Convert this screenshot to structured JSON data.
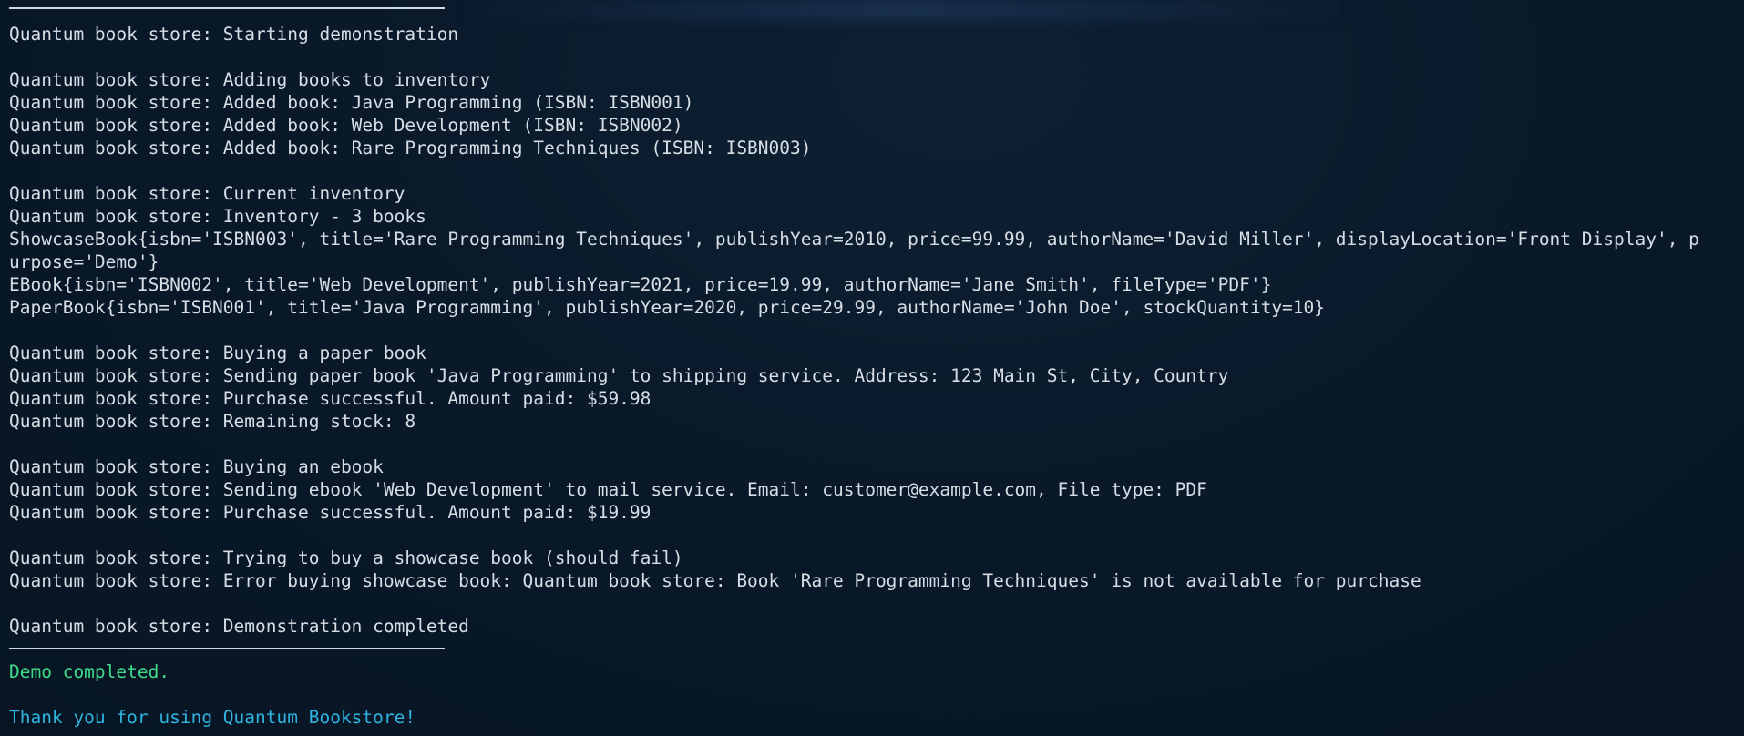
{
  "terminal": {
    "lines": [
      "Quantum book store: Starting demonstration",
      "",
      "Quantum book store: Adding books to inventory",
      "Quantum book store: Added book: Java Programming (ISBN: ISBN001)",
      "Quantum book store: Added book: Web Development (ISBN: ISBN002)",
      "Quantum book store: Added book: Rare Programming Techniques (ISBN: ISBN003)",
      "",
      "Quantum book store: Current inventory",
      "Quantum book store: Inventory - 3 books",
      "ShowcaseBook{isbn='ISBN003', title='Rare Programming Techniques', publishYear=2010, price=99.99, authorName='David Miller', displayLocation='Front Display', p",
      "urpose='Demo'}",
      "EBook{isbn='ISBN002', title='Web Development', publishYear=2021, price=19.99, authorName='Jane Smith', fileType='PDF'}",
      "PaperBook{isbn='ISBN001', title='Java Programming', publishYear=2020, price=29.99, authorName='John Doe', stockQuantity=10}",
      "",
      "Quantum book store: Buying a paper book",
      "Quantum book store: Sending paper book 'Java Programming' to shipping service. Address: 123 Main St, City, Country",
      "Quantum book store: Purchase successful. Amount paid: $59.98",
      "Quantum book store: Remaining stock: 8",
      "",
      "Quantum book store: Buying an ebook",
      "Quantum book store: Sending ebook 'Web Development' to mail service. Email: customer@example.com, File type: PDF",
      "Quantum book store: Purchase successful. Amount paid: $19.99",
      "",
      "Quantum book store: Trying to buy a showcase book (should fail)",
      "Quantum book store: Error buying showcase book: Quantum book store: Book 'Rare Programming Techniques' is not available for purchase",
      "",
      "Quantum book store: Demonstration completed"
    ],
    "demo_completed": "Demo completed.",
    "thank_you": "Thank you for using Quantum Bookstore!",
    "colors": {
      "background": "#09192a",
      "text": "#d7dde4",
      "success": "#3fdc8c",
      "info": "#2fb3e0"
    }
  }
}
